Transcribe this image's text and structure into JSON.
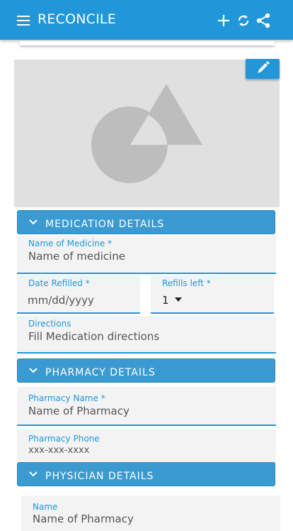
{
  "appbar": {
    "title": "RECONCILE",
    "icons": [
      "menu-icon",
      "add-icon",
      "sync-icon",
      "share-icon"
    ]
  },
  "image": {
    "icon": "pencil-icon"
  },
  "sections": {
    "medication": "MEDICATION DETAILS",
    "pharmacy": "PHARMACY DETAILS",
    "physician": "PHYSICIAN DETAILS"
  },
  "medication": {
    "name_label": "Name of Medicine *",
    "name_placeholder": "Name of medicine",
    "date_label": "Date Refilled *",
    "date_placeholder": "mm/dd/yyyy",
    "refills_label": "Refills left *",
    "refills_value": "1",
    "directions_label": "Directions",
    "directions_placeholder": "Fill Medication directions"
  },
  "pharmacy": {
    "name_label": "Pharmacy Name *",
    "name_placeholder": "Name of Pharmacy",
    "phone_label": "Pharmacy Phone",
    "phone_placeholder": "xxx-xxx-xxxx"
  },
  "physician": {
    "name_label": "Name",
    "name_placeholder": "Name of Pharmacy"
  },
  "colors": {
    "primary": "#2196d8",
    "section": "#3b9bd0",
    "field_bg": "#f3f3f3"
  }
}
